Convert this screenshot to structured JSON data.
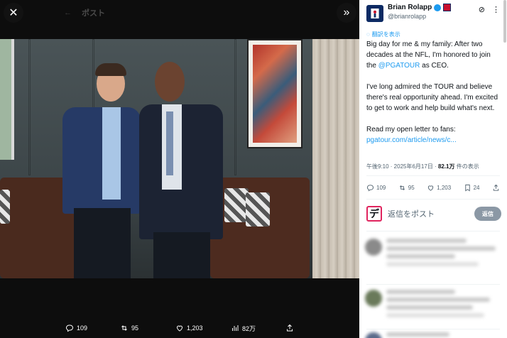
{
  "viewer": {
    "close_label": "✕",
    "expand_label": "»",
    "background_ghost": {
      "title": "ポスト"
    },
    "actions": {
      "reply_count": "109",
      "retweet_count": "95",
      "like_count": "1,203",
      "view_count": "82万"
    }
  },
  "post": {
    "author_name": "Brian Rolapp",
    "author_handle": "@brianrolapp",
    "translate_label": "翻訳を表示",
    "text_para1_pre": "Big day for me & my family: After two decades at the NFL, I'm honored to join the ",
    "mention": "@PGATOUR",
    "text_para1_post": " as CEO.",
    "text_para2": "I've long admired the TOUR and believe there's real opportunity ahead. I'm excited to get to work and help build what's next.",
    "text_para3": "Read my open letter to fans:",
    "link_text": "pgatour.com/article/news/c...",
    "timestamp": "午後9:10 · 2025年6月17日 · ",
    "views_value": "82.1万",
    "views_suffix": " 件の表示",
    "stats": {
      "replies": "109",
      "retweets": "95",
      "likes": "1,203",
      "bookmarks": "24"
    }
  },
  "reply": {
    "avatar_glyph": "デ",
    "placeholder": "返信をポスト",
    "button_label": "返信"
  },
  "colors": {
    "accent": "#1d9bf0",
    "reply_button": "#8b98a5"
  }
}
